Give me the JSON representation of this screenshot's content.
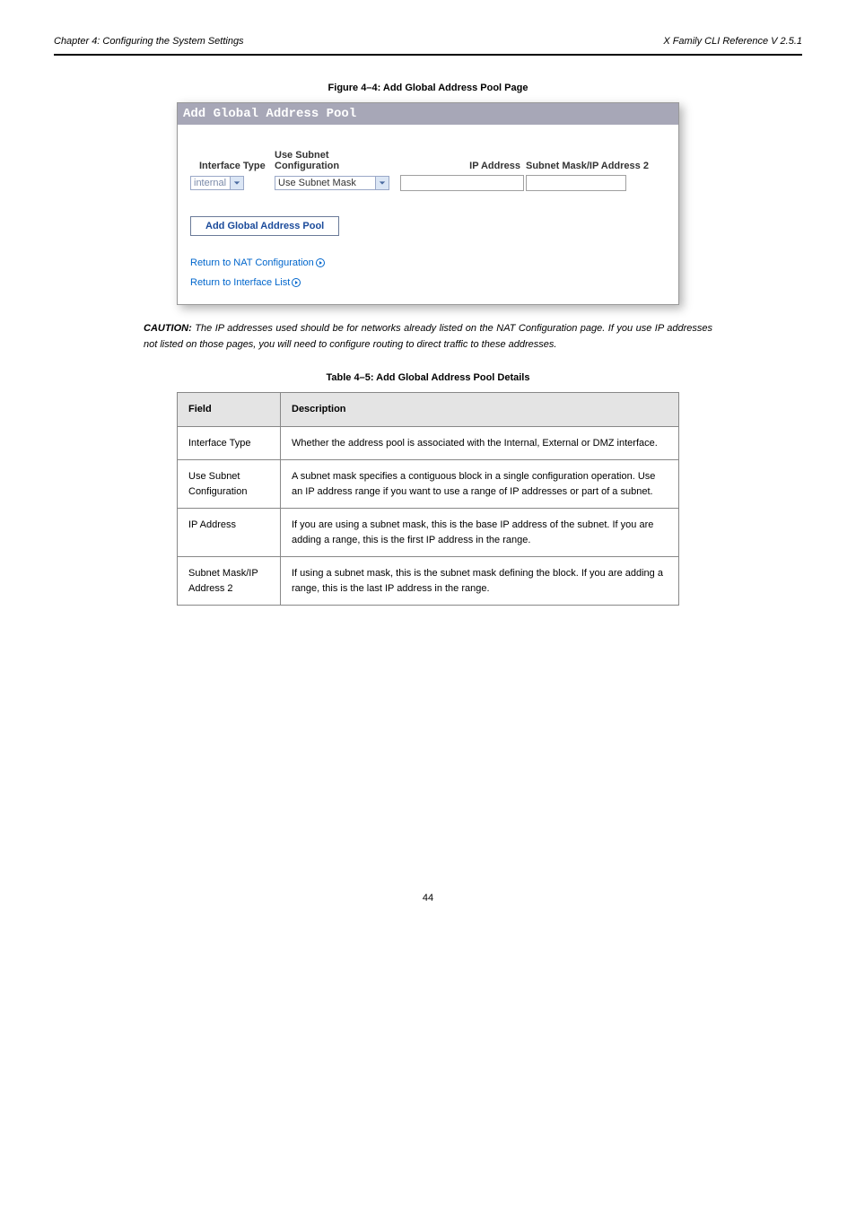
{
  "header": {
    "left": "Chapter 4: Configuring the System Settings",
    "right": "X Family CLI Reference V 2.5.1"
  },
  "figure_caption": "Figure 4–4: Add Global Address Pool Page",
  "panel": {
    "title": "Add Global Address Pool",
    "headers": {
      "iftype": "Interface Type",
      "subnet": "Use Subnet Configuration",
      "ip": "IP Address",
      "mask": "Subnet Mask/IP Address 2"
    },
    "values": {
      "iftype": "internal",
      "subnet": "Use Subnet Mask"
    },
    "add_btn": "Add Global Address Pool",
    "link1": "Return to NAT Configuration",
    "link2": "Return to Interface List"
  },
  "caution_label": "CAUTION:",
  "caution_text": "The IP addresses used should be for networks already listed on the NAT Configuration page. If you use IP addresses not listed on those pages, you will need to configure routing to direct traffic to these addresses.",
  "table_caption": "Table 4–5: Add Global Address Pool Details",
  "table": {
    "col1": "Field",
    "col2": "Description",
    "rows": [
      {
        "f": "Interface Type",
        "d": "Whether the address pool is associated with the Internal, External or DMZ interface."
      },
      {
        "f": "Use Subnet Configuration",
        "d": "A subnet mask specifies a contiguous block in a single configuration operation. Use an IP address range if you want to use a range of IP addresses or part of a subnet."
      },
      {
        "f": "IP Address",
        "d": "If you are using a subnet mask, this is the base IP address of the subnet. If you are adding a range, this is the first IP address in the range."
      },
      {
        "f": "Subnet Mask/IP Address 2",
        "d": "If using a subnet mask, this is the subnet mask defining the block. If you are adding a range, this is the last IP address in the range."
      }
    ]
  },
  "page_number": "44"
}
